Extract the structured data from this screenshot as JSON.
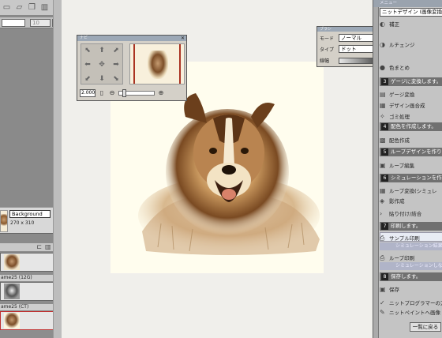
{
  "left_panel": {
    "toolbar_icons": [
      "new-file-icon",
      "open-folder-icon",
      "copy-icon",
      "trash-icon"
    ],
    "field_value": "",
    "field2_value": "10",
    "layer": {
      "name": "Background",
      "size": "270 x 310"
    },
    "timeline": {
      "frames": [
        {
          "label": ""
        },
        {
          "label": "ame25 (12G)"
        },
        {
          "label": "ame25 (CT)"
        }
      ]
    }
  },
  "navigator": {
    "title": "ナビ",
    "zoom_value": "2.000"
  },
  "brush": {
    "title": "ブラシ",
    "mode_label": "モード",
    "mode_value": "ノーマル",
    "type_label": "タイプ",
    "type_value": "ドット",
    "width_label": "線幅",
    "width_value": "1"
  },
  "right_panel": {
    "title": "メニュー",
    "dropdown": "ニットデザイン (画像変換)",
    "top_items": [
      "補正",
      "ルチェンジ",
      "色まとめ"
    ],
    "sections": [
      {
        "num": "3",
        "title": "ゲージに変換します。",
        "items": [
          "ゲージ変換",
          "デザイン画合成",
          "ゴミ処理"
        ]
      },
      {
        "num": "4",
        "title": "配色を作成します。",
        "items": [
          "配色作成"
        ]
      },
      {
        "num": "5",
        "title": "ループデザインを作ります",
        "items": [
          "ループ編集"
        ]
      },
      {
        "num": "6",
        "title": "シミュレーションを作ります",
        "items": [
          "ループ変換(シミュレ",
          "影作成"
        ]
      },
      {
        "num": "",
        "title": "",
        "items": [
          "貼り付け/結合"
        ]
      },
      {
        "num": "7",
        "title": "印刷します。",
        "items": [
          "サンプル印刷",
          "ループ印刷"
        ]
      },
      {
        "num": "8",
        "title": "保存します。",
        "items": [
          "保存"
        ]
      }
    ],
    "sub_notes": [
      "シミュレーション結果を",
      "シミュレーションしなが"
    ],
    "bottom_items": [
      "ニットプログラマーの方",
      "ニットペイントへ画像"
    ],
    "back_button": "一覧に戻る"
  }
}
